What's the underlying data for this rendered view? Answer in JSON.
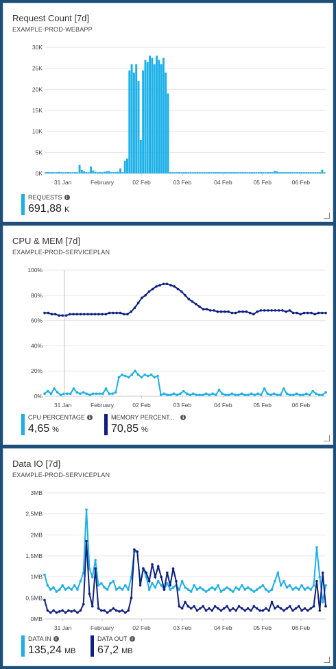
{
  "colors": {
    "cyan": "#1ab0e8",
    "navy": "#0e1f82",
    "bg": "#1d4f7a"
  },
  "tiles": {
    "requests": {
      "title": "Request Count [7d]",
      "subtitle": "EXAMPLE-PROD-WEBAPP",
      "legend": [
        {
          "name": "REQUESTS",
          "value": "691,88",
          "unit": "K",
          "color": "#1ab0e8"
        }
      ]
    },
    "cpumem": {
      "title": "CPU & MEM [7d]",
      "subtitle": "EXAMPLE-PROD-SERVICEPLAN",
      "legend": [
        {
          "name": "CPU PERCENTAGE",
          "value": "4,65",
          "unit": "%",
          "color": "#1ab0e8"
        },
        {
          "name": "MEMORY PERCENT...",
          "value": "70,85",
          "unit": "%",
          "color": "#0e1f82"
        }
      ]
    },
    "dataio": {
      "title": "Data IO [7d]",
      "subtitle": "EXAMPLE-PROD-SERVICEPLAN",
      "legend": [
        {
          "name": "DATA IN",
          "value": "135,24",
          "unit": "MB",
          "color": "#1ab0e8"
        },
        {
          "name": "DATA OUT",
          "value": "67,2",
          "unit": "MB",
          "color": "#0e1f82"
        }
      ]
    }
  },
  "chart_data": [
    {
      "type": "bar",
      "title": "Request Count [7d]",
      "x_tick_labels": [
        "31 Jan",
        "February",
        "02 Feb",
        "03 Feb",
        "04 Feb",
        "05 Feb",
        "06 Feb"
      ],
      "y_tick_labels": [
        "0K",
        "5K",
        "10K",
        "15K",
        "20K",
        "25K",
        "30K"
      ],
      "ylim": [
        0,
        30000
      ],
      "grid": true,
      "series": [
        {
          "name": "REQUESTS",
          "color": "#1ab0e8",
          "values": [
            300,
            350,
            300,
            320,
            280,
            300,
            350,
            300,
            280,
            300,
            320,
            300,
            290,
            310,
            300,
            2000,
            800,
            500,
            350,
            300,
            1600,
            700,
            400,
            300,
            350,
            300,
            400,
            500,
            600,
            300,
            300,
            350,
            400,
            1200,
            300,
            3000,
            3500,
            24500,
            26000,
            24000,
            26000,
            22000,
            8000,
            24500,
            27000,
            26500,
            28000,
            27500,
            26000,
            28000,
            27000,
            26000,
            27500,
            24000,
            19000,
            300,
            300,
            280,
            300,
            320,
            290,
            300,
            310,
            300,
            290,
            280,
            300,
            310,
            300,
            290,
            300,
            310,
            300,
            290,
            300,
            310,
            300,
            290,
            300,
            310,
            300,
            290,
            300,
            310,
            300,
            290,
            300,
            310,
            300,
            290,
            300,
            310,
            300,
            290,
            300,
            310,
            300,
            290,
            300,
            310,
            300,
            600,
            500,
            300,
            310,
            300,
            290,
            300,
            310,
            300,
            290,
            300,
            310,
            300,
            290,
            300,
            310,
            300,
            290,
            300,
            310,
            300,
            900,
            300
          ]
        }
      ]
    },
    {
      "type": "line",
      "title": "CPU & MEM [7d]",
      "x_tick_labels": [
        "31 Jan",
        "February",
        "02 Feb",
        "03 Feb",
        "04 Feb",
        "05 Feb",
        "06 Feb"
      ],
      "y_tick_labels": [
        "0%",
        "20%",
        "40%",
        "60%",
        "80%",
        "100%"
      ],
      "ylim": [
        0,
        100
      ],
      "grid": true,
      "series": [
        {
          "name": "MEMORY PERCENT...",
          "color": "#0e1f82",
          "values": [
            66,
            66,
            65,
            65,
            64,
            64,
            64,
            65,
            65,
            65,
            65,
            65,
            65,
            65,
            65,
            65,
            65,
            65,
            66,
            66,
            66,
            66,
            65,
            65,
            67,
            70,
            74,
            78,
            80,
            83,
            85,
            87,
            88,
            89,
            89,
            88,
            87,
            85,
            83,
            80,
            77,
            75,
            73,
            71,
            69,
            69,
            68,
            68,
            67,
            67,
            67,
            67,
            66,
            66,
            67,
            67,
            67,
            66,
            65,
            67,
            68,
            68,
            68,
            68,
            68,
            68,
            68,
            67,
            68,
            66,
            66,
            65,
            66,
            66,
            66,
            65,
            66,
            66,
            66
          ]
        },
        {
          "name": "CPU PERCENTAGE",
          "color": "#1ab0e8",
          "values": [
            2,
            4,
            2,
            6,
            3,
            1,
            2,
            2,
            2,
            6,
            3,
            2,
            3,
            2,
            1,
            2,
            2,
            2,
            2,
            6,
            2,
            2,
            3,
            15,
            17,
            16,
            15,
            17,
            20,
            17,
            15,
            17,
            16,
            17,
            15,
            16,
            1,
            2,
            1,
            1,
            2,
            1,
            2,
            4,
            2,
            1,
            2,
            1,
            1,
            1,
            2,
            1,
            2,
            1,
            5,
            2,
            1,
            1,
            2,
            1,
            1,
            2,
            1,
            1,
            2,
            1,
            2,
            1,
            6,
            2,
            1,
            2,
            1,
            1,
            6,
            2,
            1,
            1,
            2,
            1,
            1,
            2,
            1,
            4,
            2,
            1,
            1,
            3
          ]
        }
      ]
    },
    {
      "type": "line",
      "title": "Data IO [7d]",
      "x_tick_labels": [
        "31 Jan",
        "February",
        "02 Feb",
        "03 Feb",
        "04 Feb",
        "05 Feb",
        "06 Feb"
      ],
      "y_tick_labels": [
        "0MB",
        "0,5MB",
        "1MB",
        "1,5MB",
        "2MB",
        "2,5MB",
        "3MB"
      ],
      "ylim": [
        0,
        3
      ],
      "grid": true,
      "series": [
        {
          "name": "DATA IN",
          "color": "#1ab0e8",
          "values": [
            1.05,
            0.8,
            0.7,
            0.75,
            0.65,
            0.7,
            0.8,
            0.7,
            0.75,
            0.7,
            0.8,
            0.7,
            0.9,
            1.1,
            2.6,
            1.2,
            1.0,
            1.4,
            0.8,
            0.85,
            0.75,
            0.7,
            0.85,
            0.9,
            0.7,
            0.75,
            0.7,
            0.8,
            0.7,
            1.0,
            1.6,
            1.6,
            0.85,
            1.2,
            1.0,
            0.7,
            0.85,
            0.75,
            0.9,
            0.8,
            0.7,
            0.85,
            0.7,
            0.75,
            0.8,
            0.7,
            0.9,
            0.75,
            0.7,
            0.65,
            0.8,
            0.7,
            0.75,
            0.7,
            0.65,
            0.7,
            0.75,
            0.7,
            0.8,
            0.65,
            0.7,
            0.75,
            0.7,
            0.65,
            0.75,
            0.7,
            0.8,
            0.7,
            0.75,
            0.7,
            0.65,
            0.7,
            0.75,
            0.8,
            0.7,
            0.65,
            0.7,
            0.9,
            1.1,
            0.8,
            0.9,
            0.75,
            0.8,
            0.7,
            0.75,
            0.7,
            0.8,
            0.7,
            0.75,
            0.7,
            0.8,
            1.7,
            1.0,
            0.4,
            0.8
          ]
        },
        {
          "name": "DATA OUT",
          "color": "#0e1f82",
          "values": [
            0.45,
            0.2,
            0.15,
            0.2,
            0.15,
            0.18,
            0.2,
            0.15,
            0.2,
            0.18,
            0.2,
            0.15,
            0.2,
            0.35,
            1.85,
            0.6,
            0.3,
            1.2,
            0.25,
            0.2,
            0.2,
            0.15,
            0.2,
            0.25,
            0.2,
            0.18,
            0.2,
            0.15,
            0.2,
            0.5,
            1.65,
            1.6,
            0.8,
            1.2,
            1.1,
            0.9,
            1.3,
            1.0,
            1.25,
            1.0,
            0.7,
            1.1,
            0.8,
            1.2,
            0.9,
            0.3,
            0.25,
            0.4,
            0.3,
            0.25,
            0.3,
            0.2,
            0.25,
            0.3,
            0.2,
            0.25,
            0.2,
            0.3,
            0.25,
            0.2,
            0.25,
            0.3,
            0.2,
            0.25,
            0.2,
            0.3,
            0.25,
            0.2,
            0.25,
            0.2,
            0.3,
            0.25,
            0.2,
            0.2,
            0.25,
            0.2,
            0.4,
            0.25,
            0.3,
            0.25,
            0.2,
            0.25,
            0.3,
            0.2,
            0.25,
            0.3,
            0.2,
            0.25,
            0.2,
            0.25,
            0.3,
            0.9,
            0.2,
            1.1,
            0.3
          ]
        }
      ]
    }
  ]
}
